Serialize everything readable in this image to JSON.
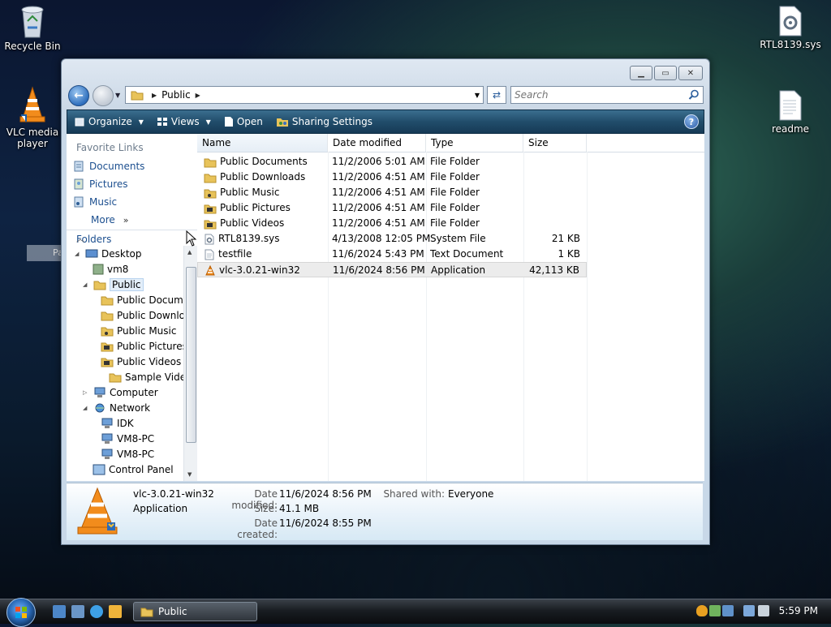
{
  "desktop": {
    "icons": [
      {
        "label": "Recycle Bin",
        "icon": "recycle-bin-icon"
      },
      {
        "label": "VLC media player",
        "icon": "vlc-icon"
      },
      {
        "label": "RTL8139.sys",
        "icon": "system-file-icon"
      },
      {
        "label": "readme",
        "icon": "text-document-icon"
      }
    ],
    "paste_ghost": "Paste"
  },
  "window": {
    "address": {
      "crumb": "Public"
    },
    "search": {
      "placeholder": "Search"
    },
    "toolbar": {
      "organize": "Organize",
      "views": "Views",
      "open": "Open",
      "sharing": "Sharing Settings"
    },
    "nav": {
      "favorites_title": "Favorite Links",
      "favorites": [
        "Documents",
        "Pictures",
        "Music",
        "More"
      ],
      "folders_label": "Folders",
      "tree": [
        {
          "label": "Desktop"
        },
        {
          "label": "vm8"
        },
        {
          "label": "Public"
        },
        {
          "label": "Public Documents"
        },
        {
          "label": "Public Downloads"
        },
        {
          "label": "Public Music"
        },
        {
          "label": "Public Pictures"
        },
        {
          "label": "Public Videos"
        },
        {
          "label": "Sample Videos"
        },
        {
          "label": "Computer"
        },
        {
          "label": "Network"
        },
        {
          "label": "IDK"
        },
        {
          "label": "VM8-PC"
        },
        {
          "label": "VM8-PC"
        },
        {
          "label": "Control Panel"
        }
      ]
    },
    "columns": [
      "Name",
      "Date modified",
      "Type",
      "Size"
    ],
    "files": [
      {
        "name": "Public Documents",
        "date": "11/2/2006 5:01 AM",
        "type": "File Folder",
        "size": "",
        "icon": "folder-docs-icon"
      },
      {
        "name": "Public Downloads",
        "date": "11/2/2006 4:51 AM",
        "type": "File Folder",
        "size": "",
        "icon": "folder-icon"
      },
      {
        "name": "Public Music",
        "date": "11/2/2006 4:51 AM",
        "type": "File Folder",
        "size": "",
        "icon": "folder-music-icon"
      },
      {
        "name": "Public Pictures",
        "date": "11/2/2006 4:51 AM",
        "type": "File Folder",
        "size": "",
        "icon": "folder-pictures-icon"
      },
      {
        "name": "Public Videos",
        "date": "11/2/2006 4:51 AM",
        "type": "File Folder",
        "size": "",
        "icon": "folder-videos-icon"
      },
      {
        "name": "RTL8139.sys",
        "date": "4/13/2008 12:05 PM",
        "type": "System File",
        "size": "21 KB",
        "icon": "system-file-icon"
      },
      {
        "name": "testfile",
        "date": "11/6/2024 5:43 PM",
        "type": "Text Document",
        "size": "1 KB",
        "icon": "text-document-icon"
      },
      {
        "name": "vlc-3.0.21-win32",
        "date": "11/6/2024 8:56 PM",
        "type": "Application",
        "size": "42,113 KB",
        "icon": "vlc-icon"
      }
    ],
    "details": {
      "name": "vlc-3.0.21-win32",
      "type": "Application",
      "date_modified_label": "Date modified:",
      "date_modified": "11/6/2024 8:56 PM",
      "size_label": "Size:",
      "size": "41.1 MB",
      "date_created_label": "Date created:",
      "date_created": "11/6/2024 8:55 PM",
      "shared_label": "Shared with:",
      "shared": "Everyone"
    }
  },
  "taskbar": {
    "task": "Public",
    "clock": "5:59 PM"
  },
  "colors": {
    "toolbar": "#214d6b",
    "link": "#1c4f8f",
    "folder": "#e8c35a",
    "vlc_orange": "#f28c1c"
  }
}
